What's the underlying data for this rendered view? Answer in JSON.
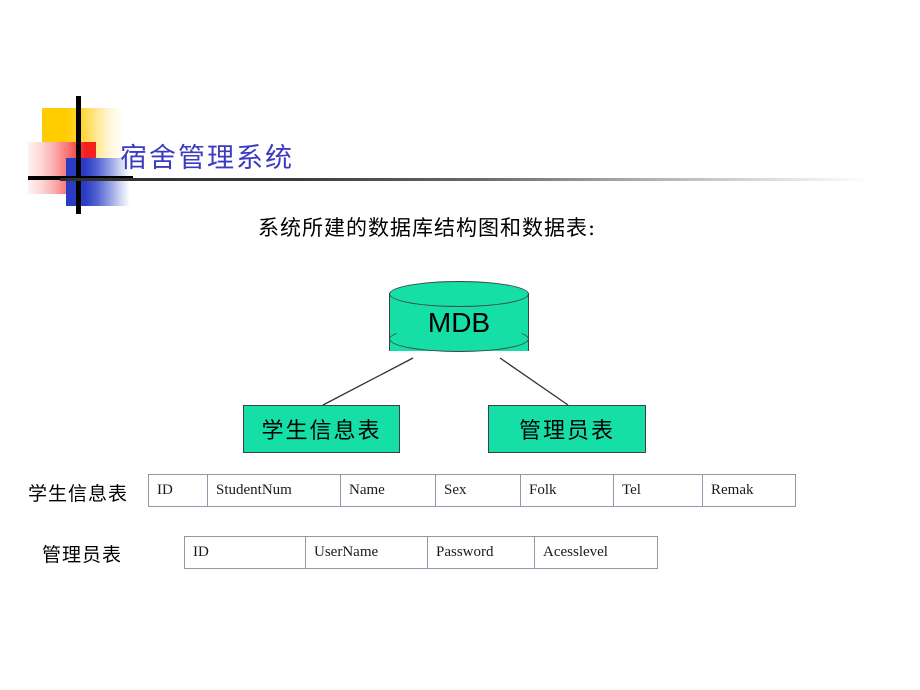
{
  "slide": {
    "title": "宿舍管理系统",
    "subtitle": "系统所建的数据库结构图和数据表:",
    "accent_color": "#3B3BC0",
    "node_fill_color": "#15DEA6",
    "logo": {
      "yellow_color": "#FFCC00",
      "red_color": "#F42020",
      "blue_color": "#2B3CC4",
      "bar_color": "#000000"
    }
  },
  "diagram": {
    "database": {
      "label": "MDB",
      "shape": "cylinder"
    },
    "nodes": [
      {
        "label": "学生信息表"
      },
      {
        "label": "管理员表"
      }
    ]
  },
  "tables": [
    {
      "row_label": "学生信息表",
      "columns": [
        "ID",
        "StudentNum",
        "Name",
        "Sex",
        "Folk",
        "Tel",
        "Remak"
      ]
    },
    {
      "row_label": "管理员表",
      "columns": [
        "ID",
        "UserName",
        "Password",
        "Acesslevel"
      ]
    }
  ]
}
